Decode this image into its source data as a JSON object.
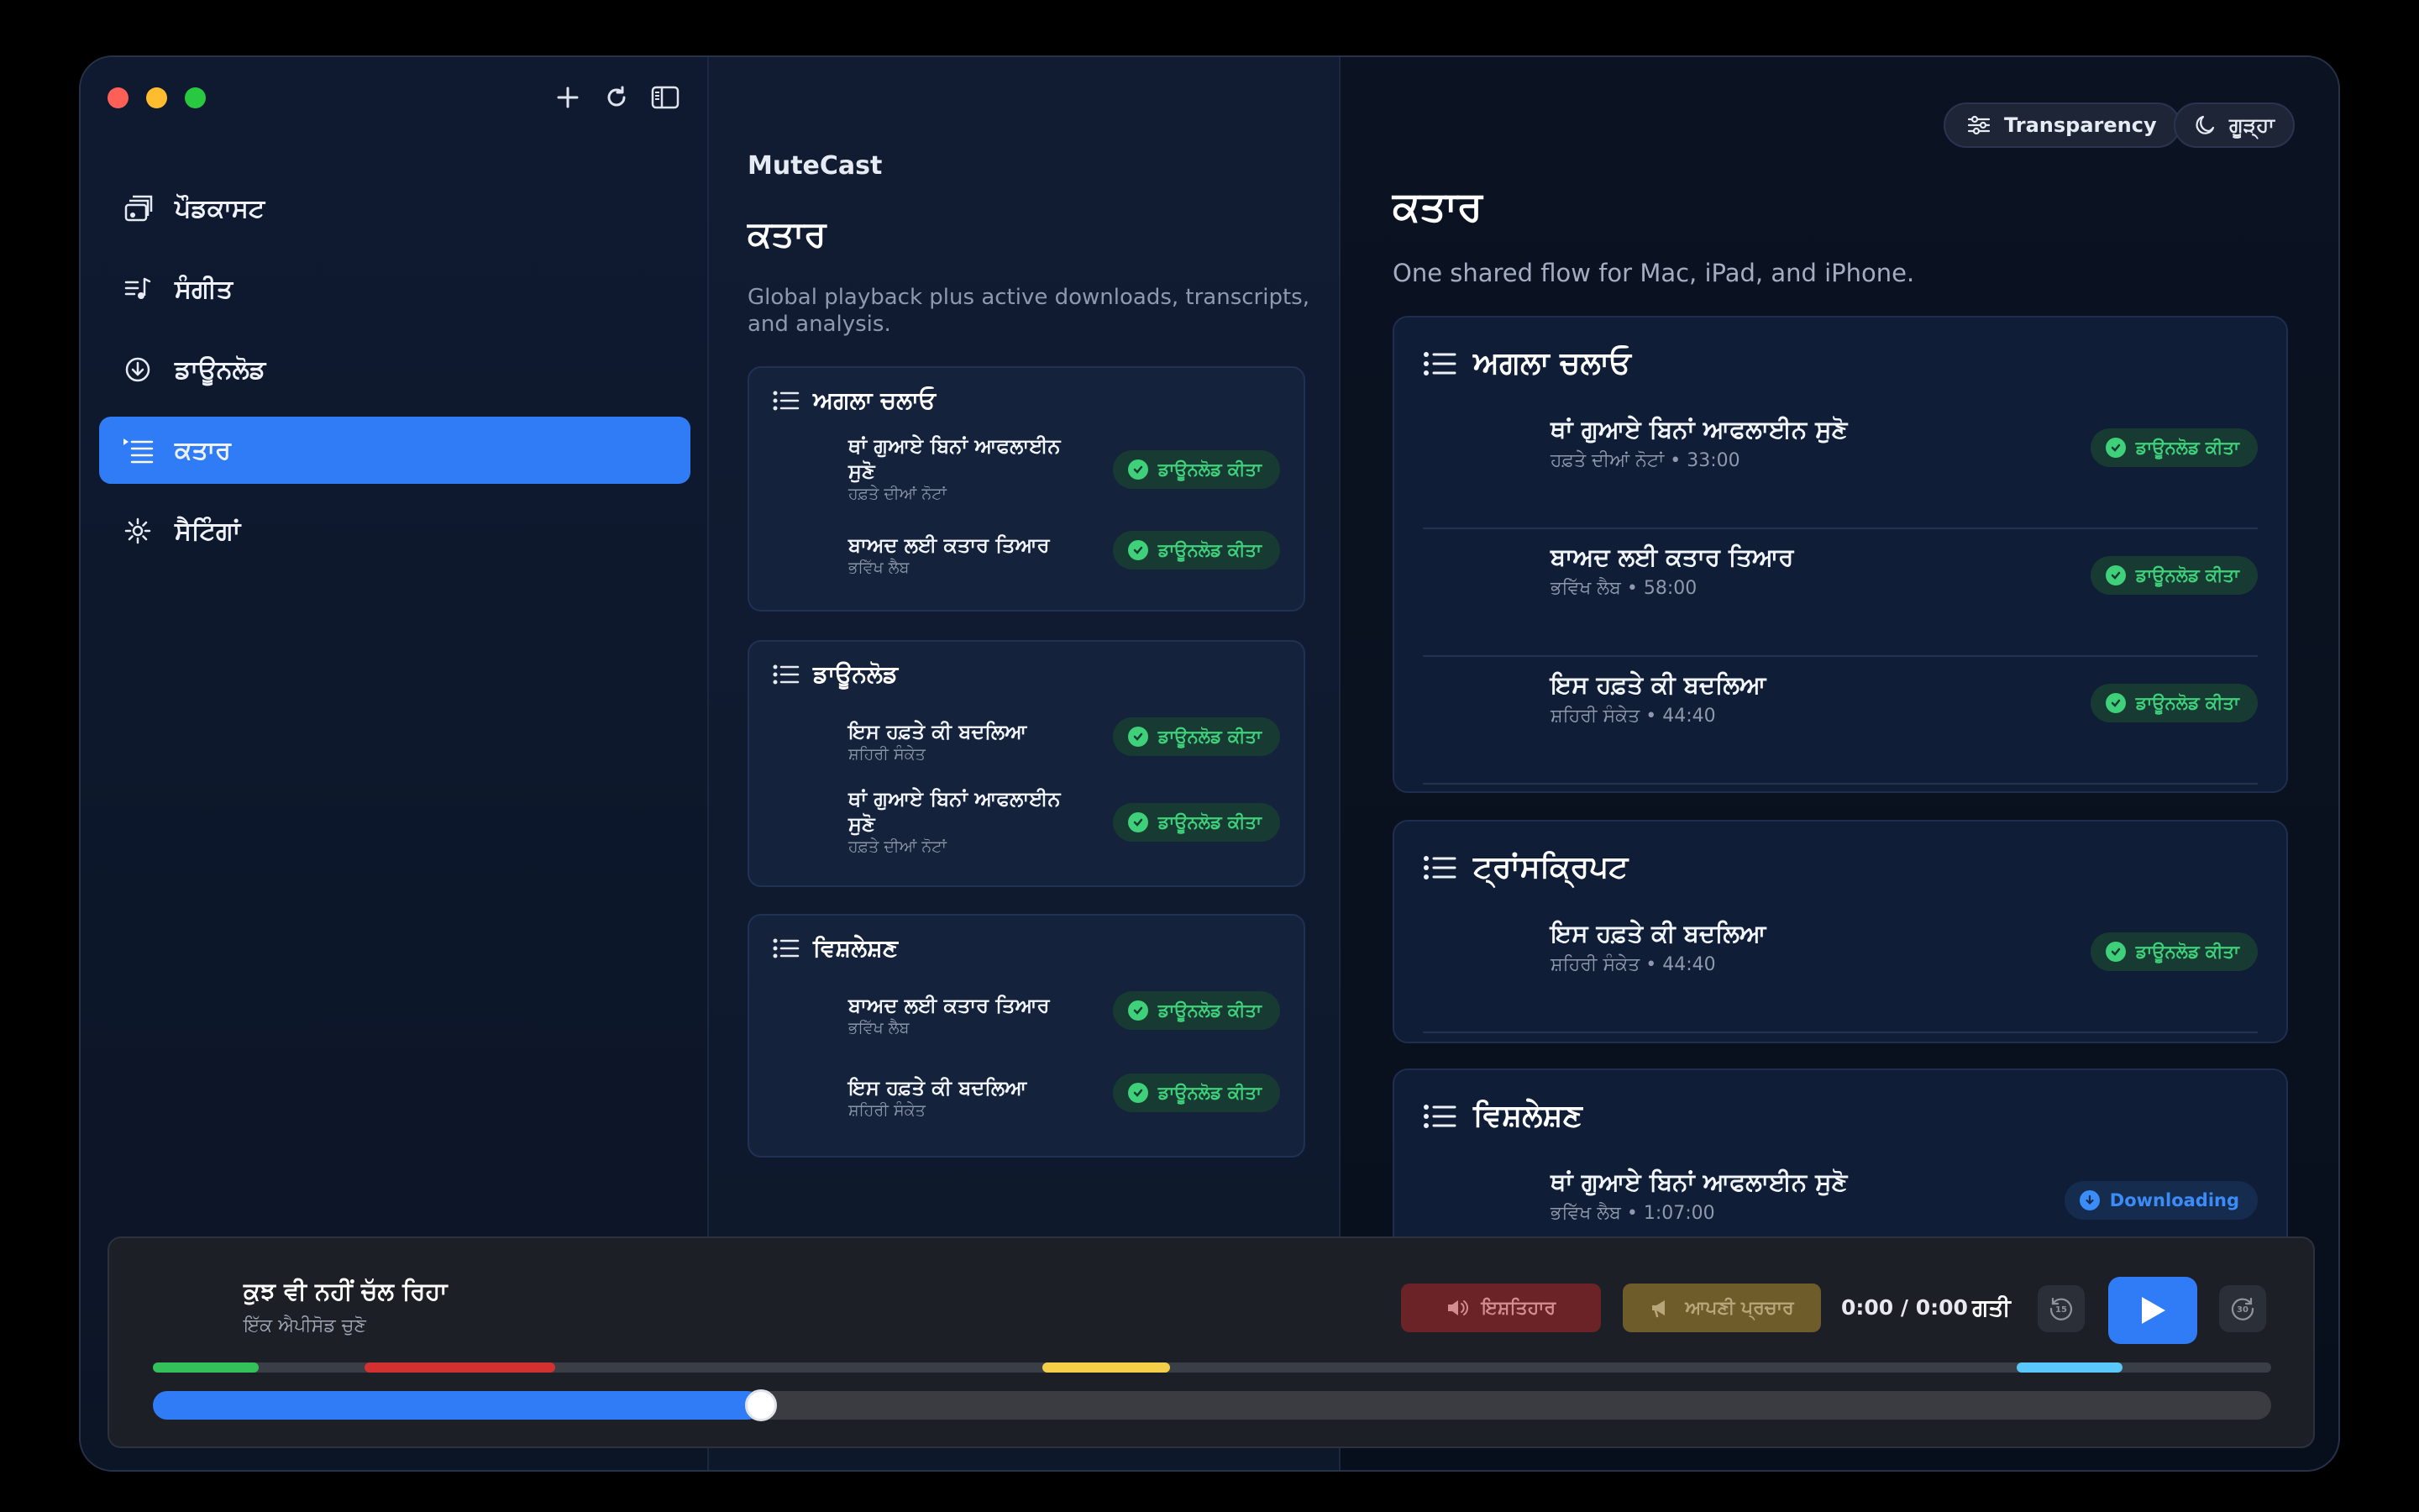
{
  "app": {
    "name": "MuteCast"
  },
  "sidebar": {
    "items": [
      {
        "label": "ਪੌਡਕਾਸਟ",
        "icon": "podcast-icon"
      },
      {
        "label": "ਸੰਗੀਤ",
        "icon": "music-icon"
      },
      {
        "label": "ਡਾਊਨਲੋਡ",
        "icon": "download-icon"
      },
      {
        "label": "ਕਤਾਰ",
        "icon": "queue-icon",
        "active": true
      },
      {
        "label": "ਸੈਟਿੰਗਾਂ",
        "icon": "gear-icon"
      }
    ]
  },
  "middle": {
    "title": "ਕਤਾਰ",
    "subtitle": "Global playback plus active downloads, transcripts, and analysis.",
    "sections": [
      {
        "heading": "ਅਗਲਾ ਚਲਾਓ",
        "rows": [
          {
            "title": "ਥਾਂ ਗੁਆਏ ਬਿਨਾਂ ਆਫਲਾਈਨ ਸੁਣੋ",
            "sub": "ਹਫ਼ਤੇ ਦੀਆਂ ਨੋਟਾਂ",
            "badge": "ਡਾਊਨਲੋਡ ਕੀਤਾ"
          },
          {
            "title": "ਬਾਅਦ ਲਈ ਕਤਾਰ ਤਿਆਰ",
            "sub": "ਭਵਿੱਖ ਲੈਬ",
            "badge": "ਡਾਊਨਲੋਡ ਕੀਤਾ"
          }
        ]
      },
      {
        "heading": "ਡਾਊਨਲੋਡ",
        "rows": [
          {
            "title": "ਇਸ ਹਫ਼ਤੇ ਕੀ ਬਦਲਿਆ",
            "sub": "ਸ਼ਹਿਰੀ ਸੰਕੇਤ",
            "badge": "ਡਾਊਨਲੋਡ ਕੀਤਾ"
          },
          {
            "title": "ਥਾਂ ਗੁਆਏ ਬਿਨਾਂ ਆਫਲਾਈਨ ਸੁਣੋ",
            "sub": "ਹਫ਼ਤੇ ਦੀਆਂ ਨੋਟਾਂ",
            "badge": "ਡਾਊਨਲੋਡ ਕੀਤਾ"
          }
        ]
      },
      {
        "heading": "ਵਿਸ਼ਲੇਸ਼ਣ",
        "rows": [
          {
            "title": "ਬਾਅਦ ਲਈ ਕਤਾਰ ਤਿਆਰ",
            "sub": "ਭਵਿੱਖ ਲੈਬ",
            "badge": "ਡਾਊਨਲੋਡ ਕੀਤਾ"
          },
          {
            "title": "ਇਸ ਹਫ਼ਤੇ ਕੀ ਬਦਲਿਆ",
            "sub": "ਸ਼ਹਿਰੀ ਸੰਕੇਤ",
            "badge": "ਡਾਊਨਲੋਡ ਕੀਤਾ"
          }
        ]
      }
    ]
  },
  "right": {
    "transparency_label": "Transparency",
    "theme_label": "ਗੂੜ੍ਹਾ",
    "title": "ਕਤਾਰ",
    "subtitle": "One shared flow for Mac, iPad, and iPhone.",
    "sections": [
      {
        "heading": "ਅਗਲਾ ਚਲਾਓ",
        "rows": [
          {
            "title": "ਥਾਂ ਗੁਆਏ ਬਿਨਾਂ ਆਫਲਾਈਨ ਸੁਣੋ",
            "sub": "ਹਫ਼ਤੇ ਦੀਆਂ ਨੋਟਾਂ • 33:00",
            "badge": "ਡਾਊਨਲੋਡ ਕੀਤਾ"
          },
          {
            "title": "ਬਾਅਦ ਲਈ ਕਤਾਰ ਤਿਆਰ",
            "sub": "ਭਵਿੱਖ ਲੈਬ • 58:00",
            "badge": "ਡਾਊਨਲੋਡ ਕੀਤਾ"
          },
          {
            "title": "ਇਸ ਹਫ਼ਤੇ ਕੀ ਬਦਲਿਆ",
            "sub": "ਸ਼ਹਿਰੀ ਸੰਕੇਤ • 44:40",
            "badge": "ਡਾਊਨਲੋਡ ਕੀਤਾ"
          }
        ]
      },
      {
        "heading": "ਟ੍ਰਾਂਸਕ੍ਰਿਪਟ",
        "rows": [
          {
            "title": "ਇਸ ਹਫ਼ਤੇ ਕੀ ਬਦਲਿਆ",
            "sub": "ਸ਼ਹਿਰੀ ਸੰਕੇਤ • 44:40",
            "badge": "ਡਾਊਨਲੋਡ ਕੀਤਾ"
          }
        ]
      },
      {
        "heading": "ਵਿਸ਼ਲੇਸ਼ਣ",
        "rows": [
          {
            "title": "ਥਾਂ ਗੁਆਏ ਬਿਨਾਂ ਆਫਲਾਈਨ ਸੁਣੋ",
            "sub": "ਭਵਿੱਖ ਲੈਬ • 1:07:00",
            "badge": "Downloading"
          }
        ]
      }
    ]
  },
  "player": {
    "title": "ਕੁਝ ਵੀ ਨਹੀਂ ਚੱਲ ਰਿਹਾ",
    "subtitle": "ਇੱਕ ਐਪੀਸੋਡ ਚੁਣੋ",
    "ad_label": "ਇਸ਼ਤਿਹਾਰ",
    "self_promo_label": "ਆਪਣੀ ਪ੍ਰਚਾਰ",
    "time": "0:00 / 0:00",
    "speed_label": "ਗਤੀ",
    "skip_back_seconds": "15",
    "skip_forward_seconds": "30",
    "progress": 0.28,
    "segments": [
      {
        "start": 0.0,
        "end": 0.05,
        "color": "#33c25a"
      },
      {
        "start": 0.1,
        "end": 0.19,
        "color": "#d2312f"
      },
      {
        "start": 0.42,
        "end": 0.48,
        "color": "#f5cf47"
      },
      {
        "start": 0.88,
        "end": 0.93,
        "color": "#5ac8fa"
      }
    ]
  }
}
